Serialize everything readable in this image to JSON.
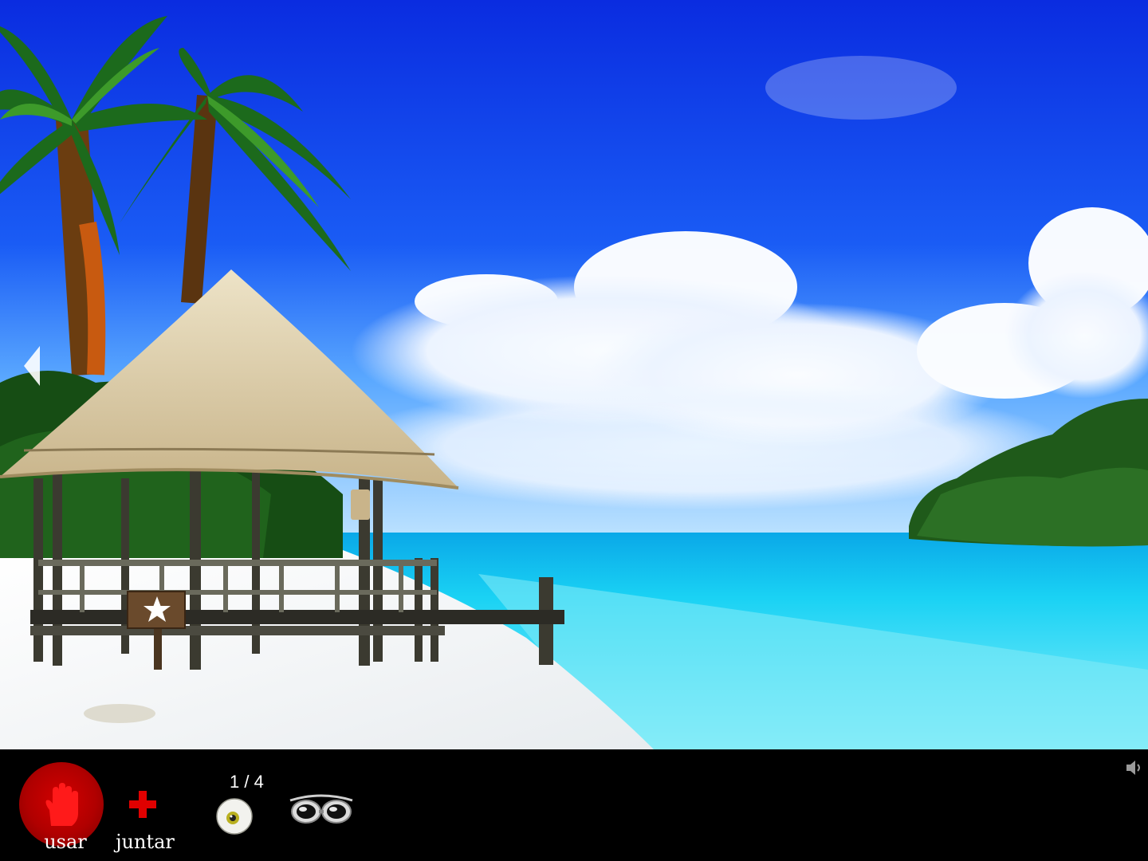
{
  "scene": {
    "description_icons": [
      "palm-tree",
      "thatched-hut",
      "pier",
      "star-sign",
      "island",
      "ocean"
    ],
    "colors": {
      "sky_top": "#0a2fe0",
      "sky_bottom": "#4aa8ff",
      "water": "#19d4f0",
      "sand": "#f4f6f8",
      "toolbar": "#000000"
    }
  },
  "toolbar": {
    "use_label": "usar",
    "collect_label": "juntar",
    "inventory_counter": "1 / 4"
  },
  "inventory": {
    "items": [
      "eyeball-icon",
      "goggles-icon"
    ]
  },
  "icons": {
    "use": "hand-icon",
    "collect": "plus-icon",
    "sound": "speaker-icon",
    "nav_left": "arrow-left-icon"
  }
}
